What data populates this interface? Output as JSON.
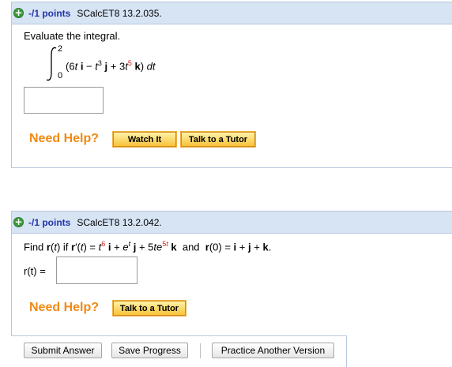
{
  "q1": {
    "points": "-/1 points",
    "id": "SCalcET8 13.2.035.",
    "prompt": "Evaluate the integral.",
    "upper": "2",
    "lower": "0",
    "need_help": "Need Help?",
    "watch_label": "Watch It",
    "tutor_label": "Talk to a Tutor"
  },
  "q2": {
    "points": "-/1 points",
    "id": "SCalcET8 13.2.042.",
    "answer_label": "r(t) =",
    "need_help": "Need Help?",
    "tutor_label": "Talk to a Tutor"
  },
  "footer": {
    "submit_label": "Submit Answer",
    "save_label": "Save Progress",
    "practice_label": "Practice Another Version"
  },
  "colors": {
    "header_bg": "#d6e4f4",
    "points_blue": "#2233aa",
    "help_orange": "#f08a13",
    "exponent_red": "#d42020"
  }
}
